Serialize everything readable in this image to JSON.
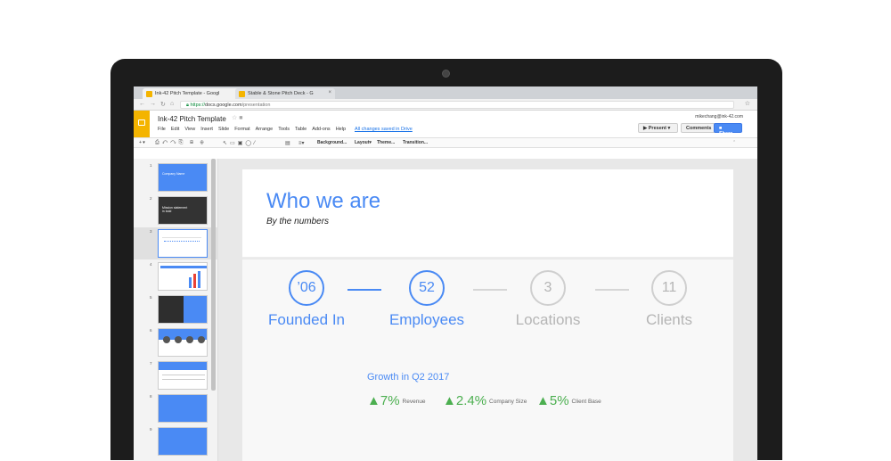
{
  "browser": {
    "tabs": [
      {
        "label": "Ink-42 Pitch Template - Googl",
        "active": true
      },
      {
        "label": "Stable & Stone Pitch Deck - G",
        "active": false
      }
    ],
    "url_scheme": "https://",
    "url_host": "docs.google.com",
    "url_path": "/presentation"
  },
  "docs": {
    "title": "Ink-42 Pitch Template",
    "account": "mikechang@ink-42.com",
    "menu": [
      "File",
      "Edit",
      "View",
      "Insert",
      "Slide",
      "Format",
      "Arrange",
      "Tools",
      "Table",
      "Add-ons",
      "Help"
    ],
    "saved_status": "All changes saved in Drive",
    "present_label": "Present",
    "comments_label": "Comments",
    "share_label": "Share"
  },
  "toolbar": {
    "background": "Background...",
    "layout": "Layout",
    "theme": "Theme...",
    "transition": "Transition..."
  },
  "filmstrip": {
    "numbers": [
      "1",
      "2",
      "3",
      "4",
      "5",
      "6",
      "7",
      "8",
      "9"
    ],
    "thumb1_title": "Company Name",
    "thumb2_title": "Mission statement in bold"
  },
  "slide": {
    "title": "Who we are",
    "subtitle": "By the numbers",
    "stats": [
      {
        "value": "’06",
        "label": "Founded In"
      },
      {
        "value": "52",
        "label": "Employees"
      },
      {
        "value": "3",
        "label": "Locations"
      },
      {
        "value": "11",
        "label": "Clients"
      }
    ],
    "growth_title": "Growth in Q2 2017",
    "growth": [
      {
        "value": "▲7%",
        "label": "Revenue"
      },
      {
        "value": "▲2.4%",
        "label": "Company Size"
      },
      {
        "value": "▲5%",
        "label": "Client Base"
      }
    ]
  },
  "colors": {
    "accent": "#4a8af4",
    "positive": "#4caf50",
    "muted": "#b5b5b5",
    "app": "#f4b400"
  }
}
